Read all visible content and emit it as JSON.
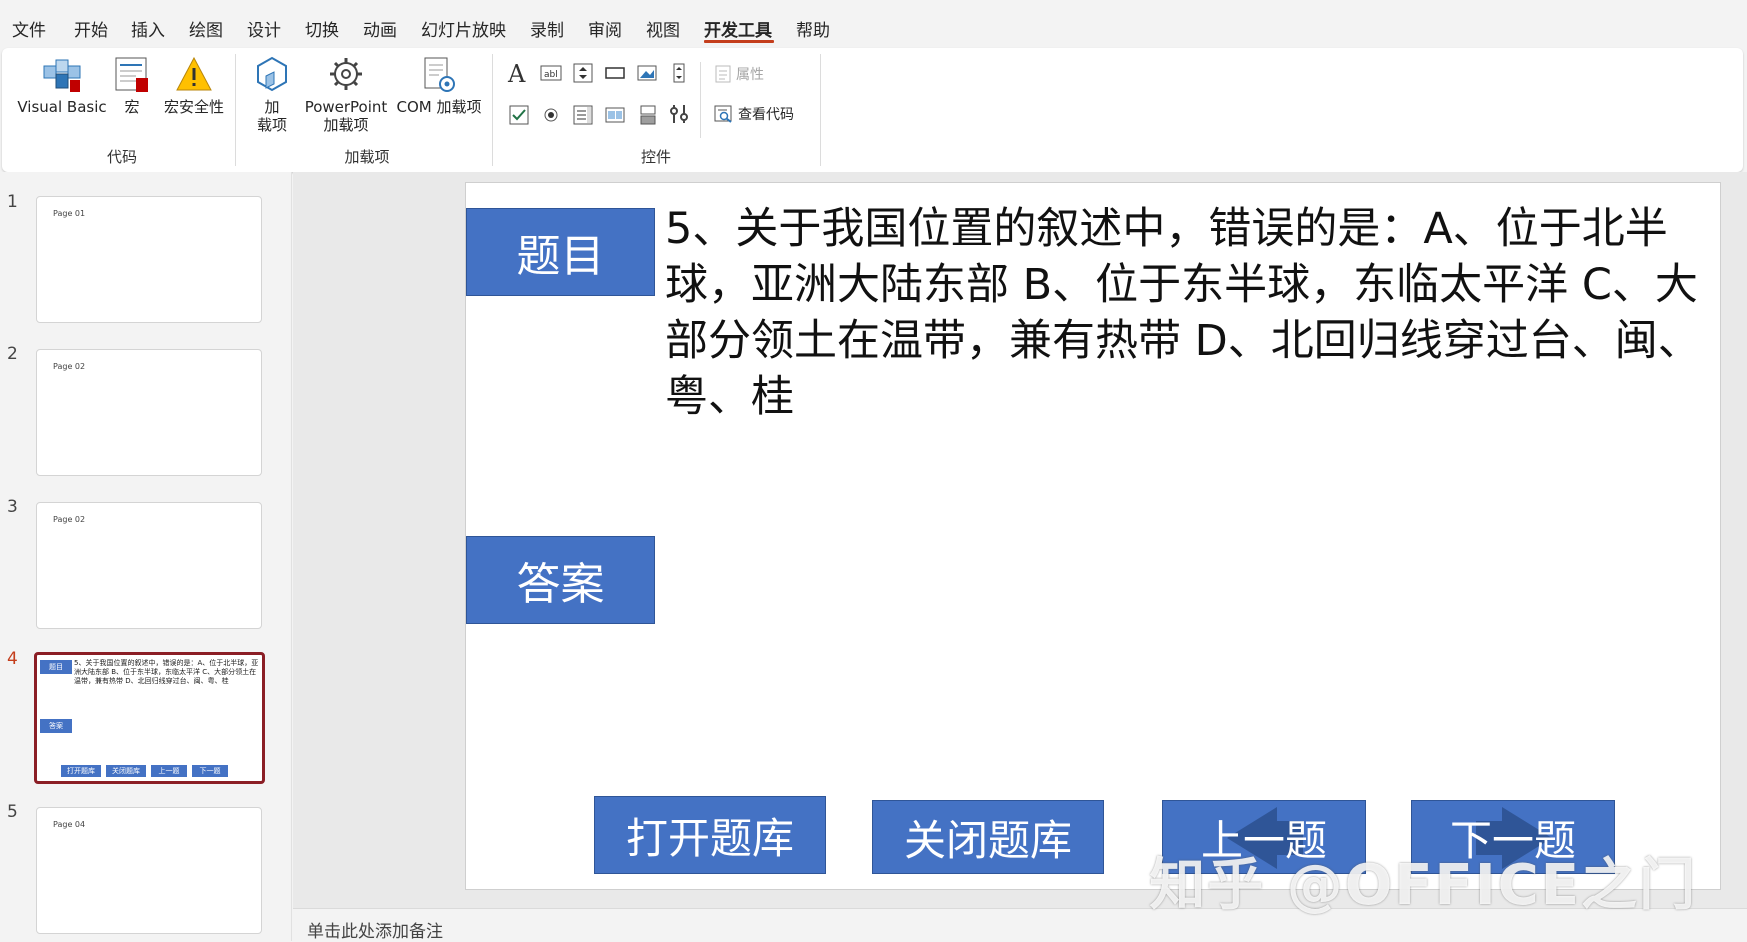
{
  "menu": {
    "items": [
      "文件",
      "开始",
      "插入",
      "绘图",
      "设计",
      "切换",
      "动画",
      "幻灯片放映",
      "录制",
      "审阅",
      "视图",
      "开发工具",
      "帮助"
    ],
    "active": "开发工具"
  },
  "ribbon": {
    "code": {
      "label": "代码",
      "visual_basic": "Visual Basic",
      "macros": "宏",
      "macro_security": "宏安全性"
    },
    "addins": {
      "label": "加载项",
      "addins_line1": "加",
      "addins_line2": "载项",
      "ppt_addins_line1": "PowerPoint",
      "ppt_addins_line2": "加载项",
      "com_addins": "COM 加载项"
    },
    "controls": {
      "label": "控件",
      "properties": "属性",
      "view_code": "查看代码"
    }
  },
  "thumbnails": [
    {
      "num": "1",
      "title": "Page 01"
    },
    {
      "num": "2",
      "title": "Page 02"
    },
    {
      "num": "3",
      "title": "Page 02"
    },
    {
      "num": "4",
      "title": "",
      "mini_question": "5、关于我国位置的叙述中，错误的是：A、位于北半球，亚洲大陆东部 B、位于东半球，东临太平洋 C、大部分领土在温带，兼有热带 D、北回归线穿过台、闽、粤、桂"
    },
    {
      "num": "5",
      "title": "Page 04"
    }
  ],
  "slide": {
    "topic_label": "题目",
    "answer_label": "答案",
    "question": "5、关于我国位置的叙述中，错误的是：A、位于北半球，亚洲大陆东部 B、位于东半球，东临太平洋 C、大部分领土在温带，兼有热带 D、北回归线穿过台、闽、粤、桂",
    "btn_open": "打开题库",
    "btn_close": "关闭题库",
    "btn_prev": "上一题",
    "btn_next": "下一题"
  },
  "notes_placeholder": "单击此处添加备注",
  "watermark": "知乎 @OFFICE之门",
  "colors": {
    "accent": "#c43e1c",
    "slide_button": "#4472c4",
    "selected_thumb_border": "#8b1e25"
  }
}
